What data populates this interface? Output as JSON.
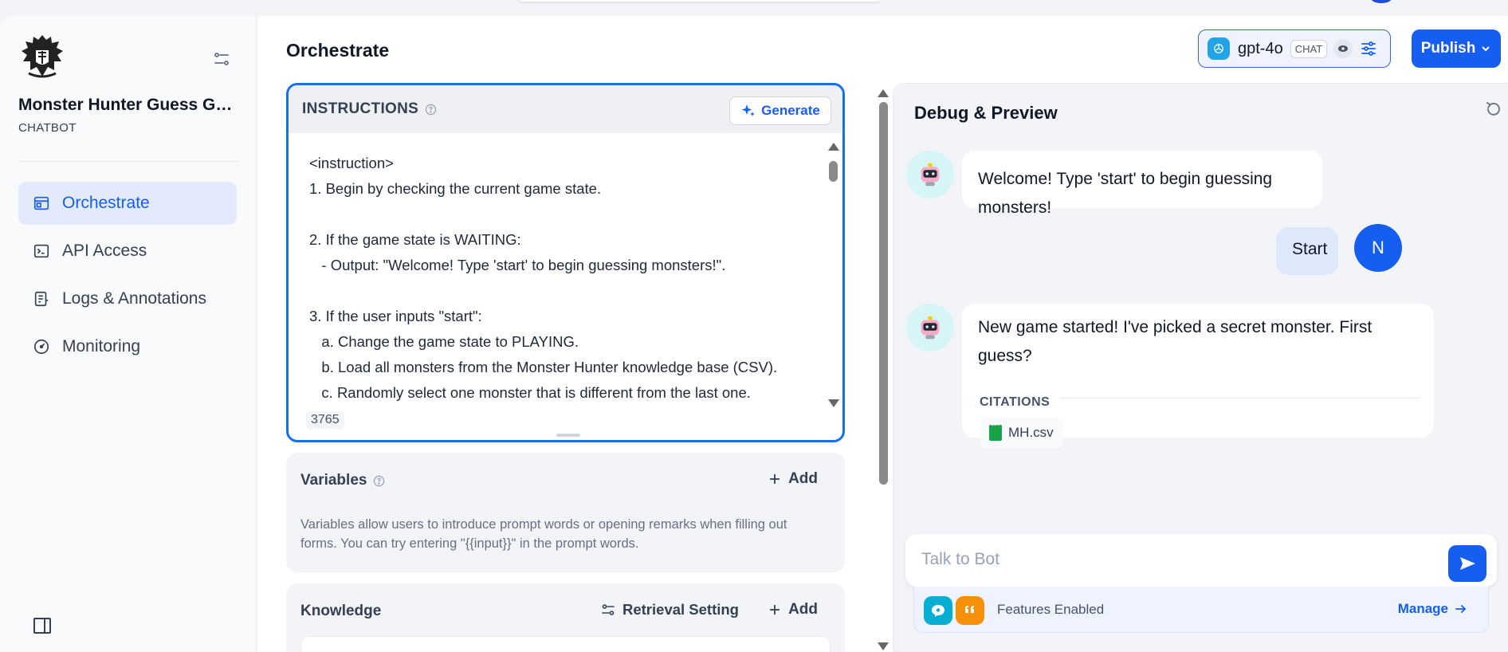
{
  "app": {
    "name": "Monster Hunter Guess Ga...",
    "type": "CHATBOT"
  },
  "sidebar": {
    "items": [
      {
        "label": "Orchestrate",
        "icon": "window-icon",
        "active": true
      },
      {
        "label": "API Access",
        "icon": "terminal-icon",
        "active": false
      },
      {
        "label": "Logs & Annotations",
        "icon": "document-list-icon",
        "active": false
      },
      {
        "label": "Monitoring",
        "icon": "gauge-icon",
        "active": false
      }
    ]
  },
  "header": {
    "title": "Orchestrate",
    "model_name": "gpt-4o",
    "model_tag": "CHAT",
    "publish_label": "Publish"
  },
  "instructions": {
    "label": "INSTRUCTIONS",
    "generate_label": "Generate",
    "lines": [
      "<instruction>",
      "1. Begin by checking the current game state.",
      "",
      "2. If the game state is WAITING:",
      "   - Output: \"Welcome! Type 'start' to begin guessing monsters!\".",
      "",
      "3. If the user inputs \"start\":",
      "   a. Change the game state to PLAYING.",
      "   b. Load all monsters from the Monster Hunter knowledge base (CSV).",
      "   c. Randomly select one monster that is different from the last one."
    ],
    "char_count": "3765"
  },
  "variables": {
    "title": "Variables",
    "add_label": "Add",
    "description": "Variables allow users to introduce prompt words or opening remarks when filling out forms. You can try entering \"{{input}}\" in the prompt words."
  },
  "knowledge": {
    "title": "Knowledge",
    "retrieval_label": "Retrieval Setting",
    "add_label": "Add"
  },
  "debug": {
    "title": "Debug & Preview",
    "messages": [
      {
        "role": "bot",
        "text": "Welcome! Type 'start' to begin guessing monsters!"
      },
      {
        "role": "user",
        "text": "Start",
        "avatar_letter": "N"
      },
      {
        "role": "bot",
        "text": "New game started! I've picked a secret monster. First guess?",
        "citations_label": "CITATIONS",
        "citation_file": "MH.csv"
      }
    ],
    "input_placeholder": "Talk to Bot",
    "features_text": "Features Enabled",
    "manage_label": "Manage"
  },
  "colors": {
    "accent": "#155eef",
    "active_nav_bg": "#e2eafc",
    "instructions_border": "#1570ef",
    "bot_avatar_bg": "#d5f5f6",
    "user_bubble_bg": "#dde8fb"
  }
}
